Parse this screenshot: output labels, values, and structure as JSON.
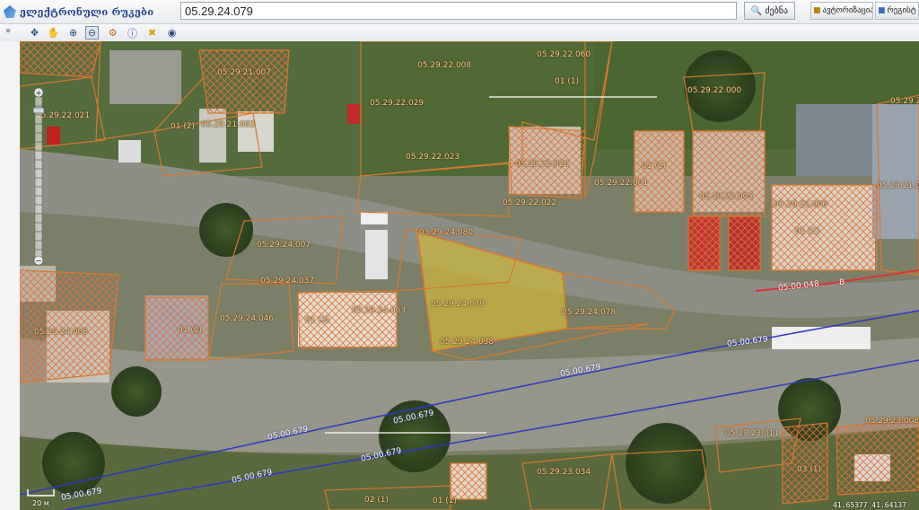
{
  "app": {
    "logo_text": "ელექტრონული რუკები"
  },
  "search": {
    "value": "05.29.24.079",
    "button_label": "ძებნა"
  },
  "top_buttons": [
    {
      "label": "ავტორიზაცია"
    },
    {
      "label": "რეგისტ"
    }
  ],
  "toolbar": {
    "collapse": "»",
    "tools": [
      "move-icon",
      "pan-icon",
      "zoom-in-icon",
      "zoom-out-icon",
      "measure-icon",
      "info-icon",
      "clear-icon",
      "globe-icon"
    ]
  },
  "colors": {
    "parcel": "#d9782f",
    "blue_line": "#2a38c8",
    "red_line": "#e03030",
    "highlight": "#c8b43c",
    "label": "#ffcf9a"
  },
  "map": {
    "parcels": [
      {
        "code": "05.29.22.021"
      },
      {
        "code": "05.29.21.007"
      },
      {
        "code": "05.29.22.060"
      },
      {
        "code": "05.29.21.002"
      },
      {
        "code": "05.29.22.008"
      },
      {
        "code": "05.29.22.023"
      },
      {
        "code": "05.29.22.029"
      },
      {
        "code": "05.29.22.020"
      },
      {
        "code": "05.29.22.001"
      },
      {
        "code": "05.29.22.005"
      },
      {
        "code": "05.29.22.006"
      },
      {
        "code": "05.29.22.022"
      },
      {
        "code": "05.29.24.080"
      },
      {
        "code": "05.29.24.079"
      },
      {
        "code": "05.29.24.037"
      },
      {
        "code": "05.29.24.063"
      },
      {
        "code": "05.29.24.078"
      },
      {
        "code": "05.29.24.038"
      },
      {
        "code": "05.29.24.008"
      },
      {
        "code": "05.29.24.046"
      },
      {
        "code": "05.29.22.000"
      },
      {
        "code": "05.29.21.020"
      },
      {
        "code": "05.29.23.011"
      },
      {
        "code": "05.29.23.034"
      },
      {
        "code": "05.29.23.008"
      },
      {
        "code": "05.29.24.007"
      },
      {
        "code": "05.29.22.024"
      }
    ],
    "units": [
      "01 (1)",
      "01 (2)",
      "01 (3)",
      "01 (1)",
      "01 (1)",
      "01 (1)",
      "03 (1)",
      "02 (1)",
      "01 (1)"
    ],
    "roads": [
      {
        "code": "05.00.679"
      },
      {
        "code": "05.00.048"
      }
    ],
    "letter_b": "B",
    "scale_label": "20 м",
    "coords": "41.65377  41.64137"
  }
}
